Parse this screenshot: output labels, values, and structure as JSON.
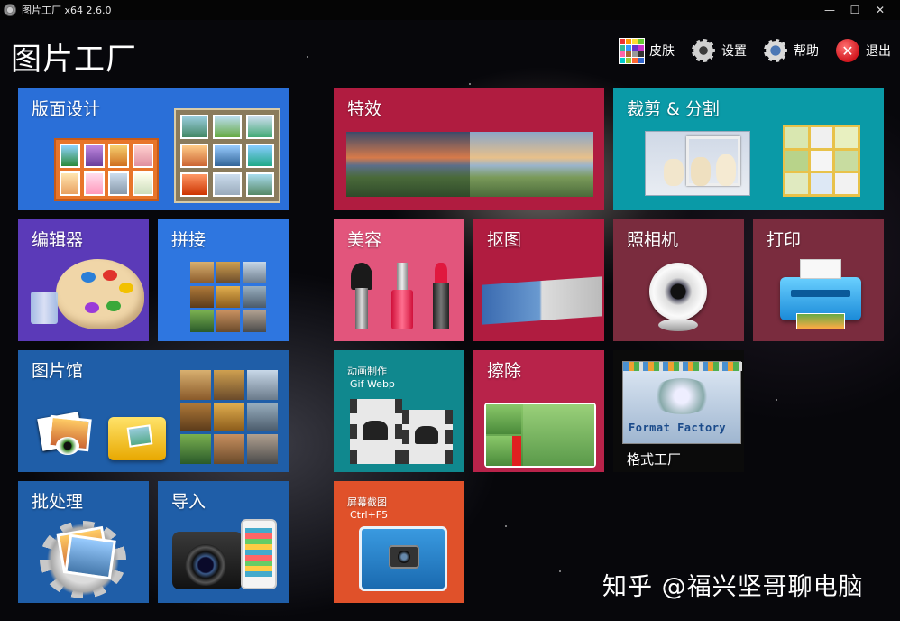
{
  "window": {
    "title": "图片工厂 x64 2.6.0",
    "controls": {
      "minimize": "—",
      "maximize": "☐",
      "close": "✕"
    }
  },
  "app_title": "图片工厂",
  "header": {
    "skin": "皮肤",
    "settings": "设置",
    "help": "帮助",
    "exit": "退出"
  },
  "tiles": {
    "layout_design": "版面设计",
    "effects": "特效",
    "crop_split": "裁剪 & 分割",
    "editor": "编辑器",
    "stitch": "拼接",
    "beauty": "美容",
    "cutout": "抠图",
    "camera": "照相机",
    "print": "打印",
    "gallery": "图片馆",
    "animation": "动画制作",
    "animation_sub": "Gif Webp",
    "erase": "擦除",
    "format_factory": "格式工厂",
    "format_factory_logo": "Format Factory",
    "batch": "批处理",
    "import": "导入",
    "screenshot": "屏幕截图",
    "screenshot_sub": "Ctrl+F5"
  },
  "watermark": "知乎 @福兴坚哥聊电脑",
  "colors": {
    "layout_design": "#2a6fd8",
    "effects": "#b01c40",
    "crop_split": "#0a9aa7",
    "editor": "#5b3ab8",
    "stitch": "#2e76e0",
    "beauty": "#e2557c",
    "cutout": "#b01c40",
    "camera": "#7a2c3e",
    "print": "#7a2c3e",
    "gallery": "#1f5ea8",
    "animation": "#10888e",
    "erase": "#b8234a",
    "format_factory": "#0b0b0b",
    "batch": "#1f5ea8",
    "import": "#1f5ea8",
    "screenshot": "#e0512a"
  }
}
